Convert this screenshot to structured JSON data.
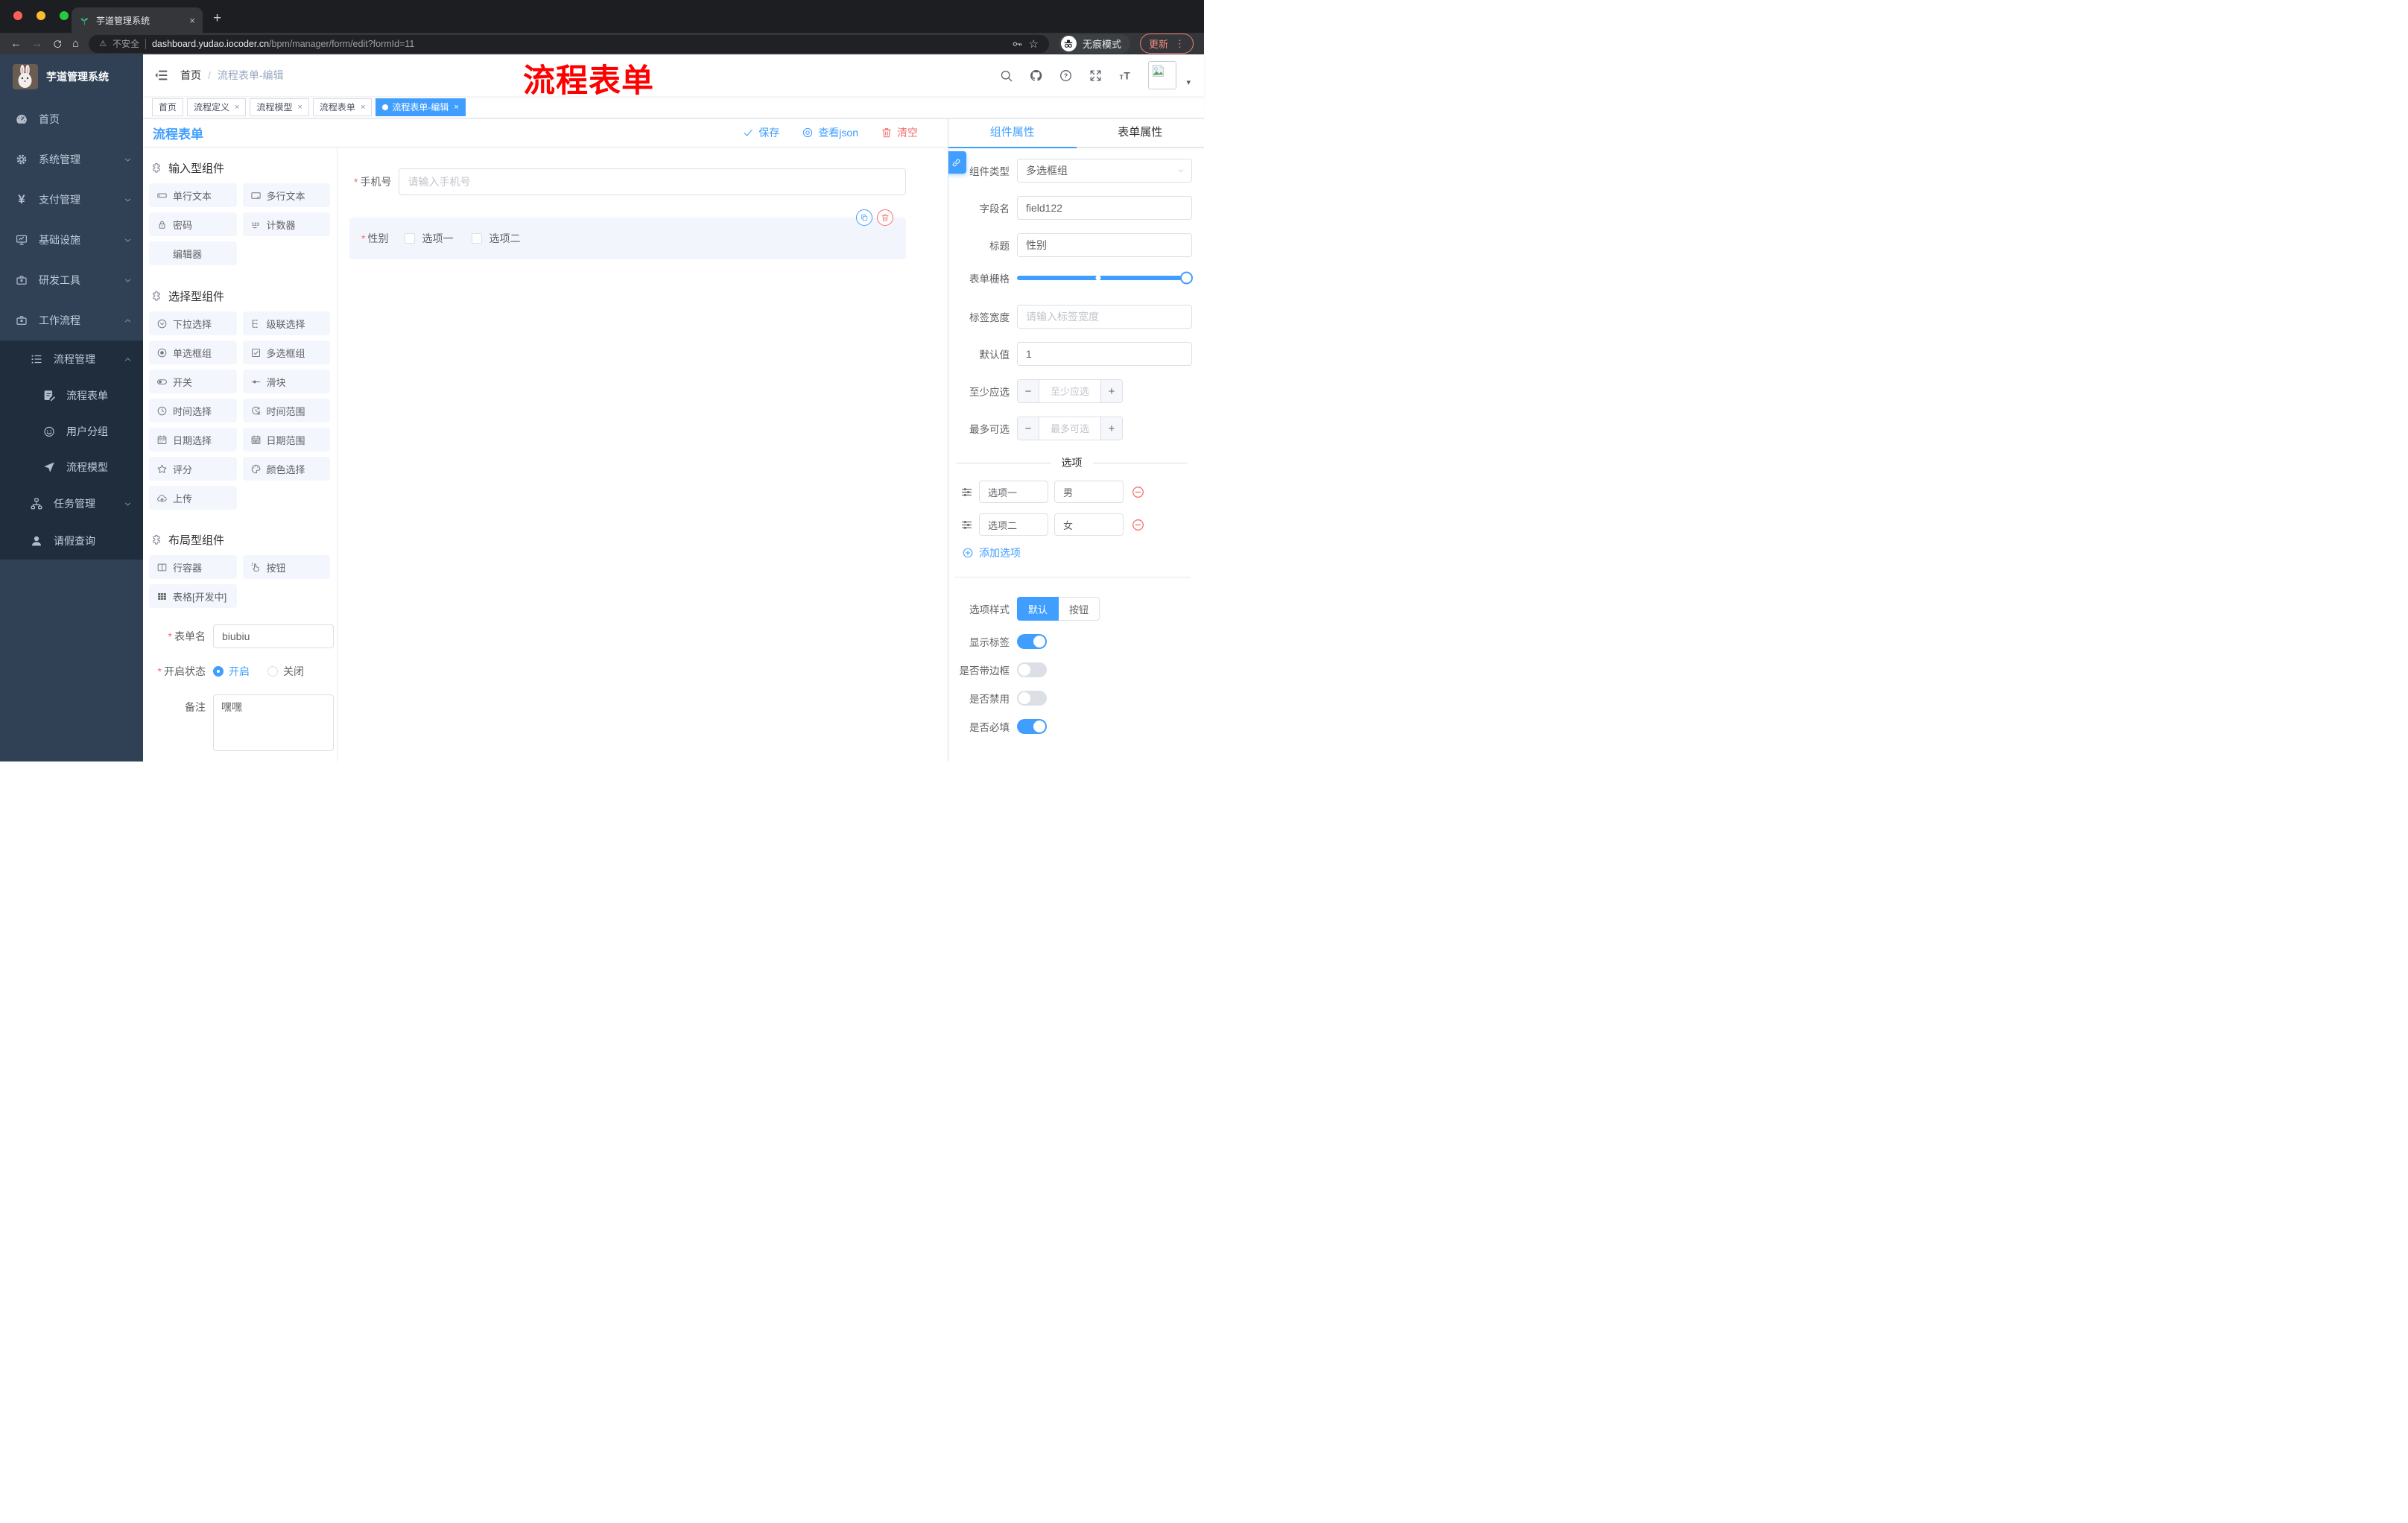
{
  "colors": {
    "primary": "#409eff",
    "danger": "#f56c6c",
    "sidebar_bg": "#304156",
    "submenu_bg": "#1f2d3d",
    "annotation": "#ff0000",
    "traffic_red": "#ff5f57",
    "traffic_yellow": "#fdbc2e",
    "traffic_green": "#28c841"
  },
  "annotation": {
    "text": "流程表单"
  },
  "browser": {
    "tab_title": "芋道管理系统",
    "close_glyph": "×",
    "new_tab_glyph": "+",
    "back_glyph": "←",
    "forward_glyph": "→",
    "home_glyph": "⌂",
    "security_label": "不安全",
    "url_host": "dashboard.yudao.iocoder.cn",
    "url_path": "/bpm/manager/form/edit?formId=11",
    "incognito_label": "无痕模式",
    "update_label": "更新",
    "menu_dots_glyph": "⋮",
    "star_glyph": "☆",
    "warning_glyph": "⚠",
    "caret_glyph": "▾"
  },
  "sidebar": {
    "logo_title": "芋道管理系统",
    "menu": [
      {
        "label": "首页",
        "icon": "dashboard-icon"
      },
      {
        "label": "系统管理",
        "icon": "gear-icon"
      },
      {
        "label": "支付管理",
        "icon": "yen-icon",
        "yen_glyph": "¥"
      },
      {
        "label": "基础设施",
        "icon": "monitor-icon"
      },
      {
        "label": "研发工具",
        "icon": "toolbox-icon"
      },
      {
        "label": "工作流程",
        "icon": "briefcase-icon"
      }
    ],
    "submenu": {
      "group_label": "流程管理",
      "children": [
        {
          "label": "流程表单",
          "icon": "doc-edit-icon"
        },
        {
          "label": "用户分组",
          "icon": "face-icon"
        },
        {
          "label": "流程模型",
          "icon": "send-icon"
        }
      ],
      "siblings": [
        {
          "label": "任务管理",
          "icon": "tree-icon"
        },
        {
          "label": "请假查询",
          "icon": "user-icon"
        }
      ]
    }
  },
  "navbar": {
    "breadcrumb": {
      "first": "首页",
      "sep": "/",
      "current": "流程表单-编辑"
    }
  },
  "tags": [
    {
      "label": "首页"
    },
    {
      "label": "流程定义"
    },
    {
      "label": "流程模型"
    },
    {
      "label": "流程表单"
    },
    {
      "label": "流程表单-编辑"
    }
  ],
  "editor": {
    "title": "流程表单",
    "actions": {
      "save": "保存",
      "view_json": "查看json",
      "clear": "清空"
    },
    "palette": {
      "sections": [
        {
          "title": "输入型组件",
          "items": [
            {
              "label": "单行文本",
              "icon": "textfield-icon"
            },
            {
              "label": "多行文本",
              "icon": "textarea-icon"
            },
            {
              "label": "密码",
              "icon": "lock-icon"
            },
            {
              "label": "计数器",
              "icon": "counter-icon"
            },
            {
              "label": "编辑器",
              "icon": ""
            }
          ]
        },
        {
          "title": "选择型组件",
          "items": [
            {
              "label": "下拉选择",
              "icon": "select-icon"
            },
            {
              "label": "级联选择",
              "icon": "cascader-icon"
            },
            {
              "label": "单选框组",
              "icon": "radio-icon"
            },
            {
              "label": "多选框组",
              "icon": "checkbox-icon"
            },
            {
              "label": "开关",
              "icon": "switch-icon"
            },
            {
              "label": "滑块",
              "icon": "slider-icon"
            },
            {
              "label": "时间选择",
              "icon": "time-icon"
            },
            {
              "label": "时间范围",
              "icon": "time-range-icon"
            },
            {
              "label": "日期选择",
              "icon": "date-icon"
            },
            {
              "label": "日期范围",
              "icon": "date-range-icon"
            },
            {
              "label": "评分",
              "icon": "star-icon"
            },
            {
              "label": "颜色选择",
              "icon": "palette-icon"
            },
            {
              "label": "上传",
              "icon": "upload-icon"
            }
          ]
        },
        {
          "title": "布局型组件",
          "items": [
            {
              "label": "行容器",
              "icon": "row-container-icon"
            },
            {
              "label": "按钮",
              "icon": "button-icon"
            },
            {
              "label": "表格[开发中]",
              "icon": "table-icon"
            }
          ]
        }
      ]
    },
    "form_meta": {
      "name_label": "表单名",
      "name_value": "biubiu",
      "status_label": "开启状态",
      "status_on": "开启",
      "status_off": "关闭",
      "remark_label": "备注",
      "remark_value": "嘿嘿"
    },
    "canvas": {
      "phone_label": "手机号",
      "phone_placeholder": "请输入手机号",
      "gender_label": "性别",
      "gender_options": [
        "选项一",
        "选项二"
      ]
    }
  },
  "inspector": {
    "tabs": [
      "组件属性",
      "表单属性"
    ],
    "component_type_label": "组件类型",
    "component_type_value": "多选框组",
    "field_name_label": "字段名",
    "field_name_value": "field122",
    "title_label": "标题",
    "title_value": "性别",
    "grid_label": "表单栅格",
    "label_width_label": "标签宽度",
    "label_width_placeholder": "请输入标签宽度",
    "default_label": "默认值",
    "default_value": "1",
    "min_label": "至少应选",
    "min_placeholder": "至少应选",
    "max_label": "最多可选",
    "max_placeholder": "最多可选",
    "stepper_minus": "−",
    "stepper_plus": "+",
    "options_divider": "选项",
    "option_rows": [
      {
        "label": "选项一",
        "value": "男"
      },
      {
        "label": "选项二",
        "value": "女"
      }
    ],
    "add_option_label": "添加选项",
    "style_label": "选项样式",
    "style_default": "默认",
    "style_button": "按钮",
    "toggles": [
      {
        "label": "显示标签",
        "on": true
      },
      {
        "label": "是否带边框",
        "on": false
      },
      {
        "label": "是否禁用",
        "on": false
      },
      {
        "label": "是否必填",
        "on": true
      }
    ]
  }
}
